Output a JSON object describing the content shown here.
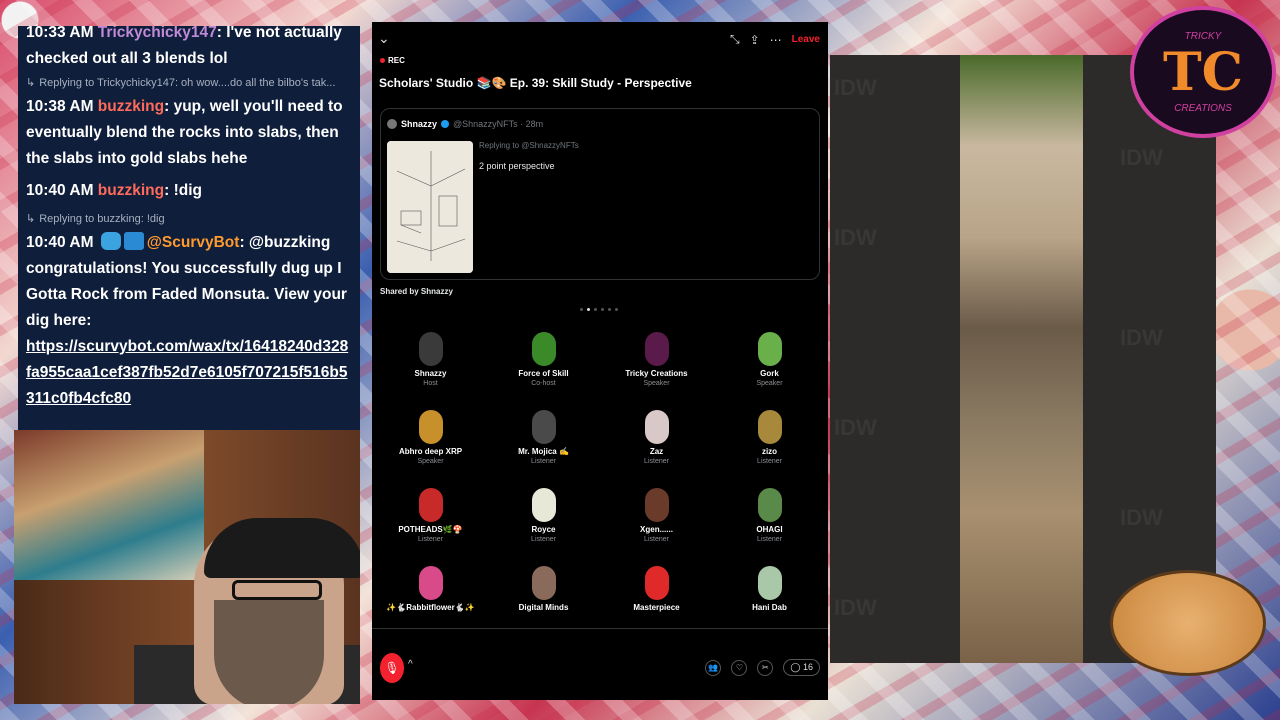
{
  "chat": {
    "messages": [
      {
        "time": "10:33 AM",
        "user": "Trickychicky147",
        "text": ": I've not actually checked out all 3 blends lol"
      },
      {
        "reply": "Replying to Trickychicky147: oh wow....do all the bilbo's tak..."
      },
      {
        "time": "10:38 AM",
        "user": "buzzking",
        "text": ": yup, well you'll need to eventually blend the rocks into slabs, then the slabs into gold slabs hehe"
      },
      {
        "time": "10:40 AM",
        "user": "buzzking",
        "text": ": !dig"
      },
      {
        "reply": "Replying to buzzking: !dig"
      },
      {
        "time": "10:40 AM",
        "user": "@ScurvyBot",
        "text": ": @buzzking congratulations! You successfully dug up I Gotta Rock from Faded Monsuta. View your dig here:"
      }
    ],
    "link": "https://scurvybot.com/wax/tx/16418240d328fa955caa1cef387fb52d7e6105f707215f516b5311c0fb4cfc80"
  },
  "spaces": {
    "leave_label": "Leave",
    "rec_label": "REC",
    "title": "Scholars' Studio 📚🎨 Ep. 39: Skill Study - Perspective",
    "tweet": {
      "author": "Shnazzy",
      "handle": "@ShnazzyNFTs · 28m",
      "replying": "Replying to @ShnazzyNFTs",
      "text": "2 point perspective"
    },
    "shared_by": "Shared by Shnazzy",
    "participants": [
      {
        "name": "Shnazzy",
        "role": "Host",
        "color": "#3a3a3a"
      },
      {
        "name": "Force of Skill",
        "role": "Co-host",
        "color": "#3a8a2a"
      },
      {
        "name": "Tricky Creations",
        "role": "Speaker",
        "color": "#5a1a4a"
      },
      {
        "name": "Gork",
        "role": "Speaker",
        "color": "#6ab04a"
      },
      {
        "name": "Abhro deep XRP",
        "role": "Speaker",
        "color": "#c8902a"
      },
      {
        "name": "Mr. Mojica ✍️",
        "role": "Listener",
        "color": "#4a4a4a"
      },
      {
        "name": "Zaz",
        "role": "Listener",
        "color": "#d8c8c8"
      },
      {
        "name": "zizo",
        "role": "Listener",
        "color": "#a8883a"
      },
      {
        "name": "POTHEADS🌿🍄",
        "role": "Listener",
        "color": "#c82a2a"
      },
      {
        "name": "Royce",
        "role": "Listener",
        "color": "#e8e8d8"
      },
      {
        "name": "Xgen......",
        "role": "Listener",
        "color": "#6a3a2a"
      },
      {
        "name": "OHAGI",
        "role": "Listener",
        "color": "#5a8a4a"
      },
      {
        "name": "✨🐇Rabbitflower🐇✨",
        "role": "",
        "color": "#d84a8a"
      },
      {
        "name": "Digital Minds",
        "role": "",
        "color": "#8a6a5a"
      },
      {
        "name": "Masterpiece",
        "role": "",
        "color": "#e02a2a"
      },
      {
        "name": "Hani Dab",
        "role": "",
        "color": "#a8c8a8"
      }
    ],
    "reply_count": "16"
  },
  "overlay": {
    "logo_tc": "TC",
    "logo_top": "TRICKY",
    "logo_bottom": "CREATIONS",
    "watermark": "IDW"
  }
}
